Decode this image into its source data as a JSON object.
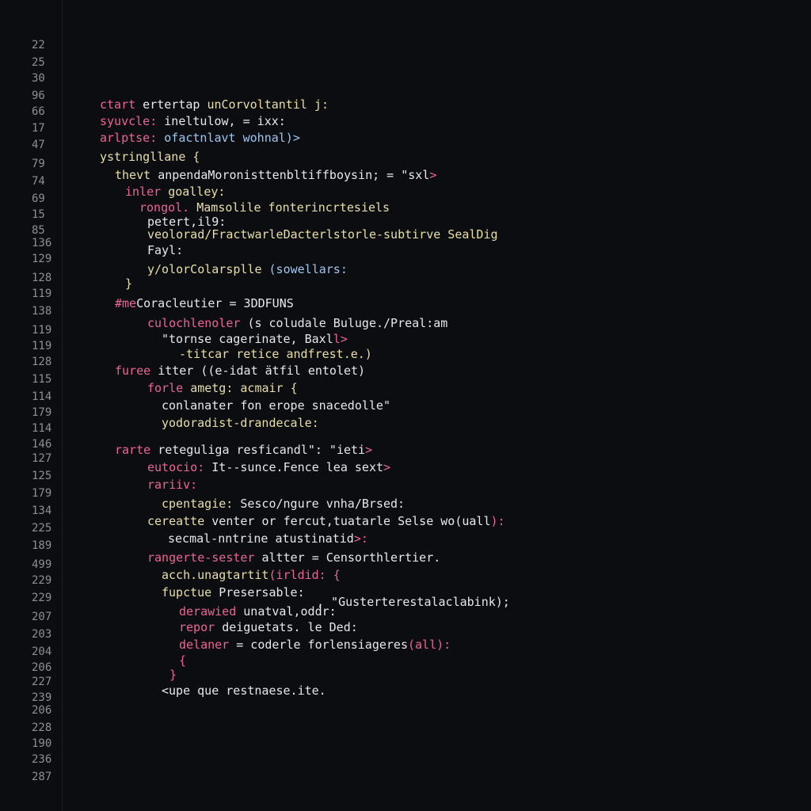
{
  "editor": {
    "theme": {
      "background": "#0b0d11",
      "keyword": "#ec6592",
      "function": "#e9dfa6",
      "text": "#e6e8ee",
      "accent": "#9fc6ee",
      "line_number": "#8c9096"
    },
    "line_numbers": [
      "22",
      "25",
      "30",
      "96",
      "66",
      "17",
      "47",
      "79",
      "74",
      "69",
      "15",
      "85",
      "136",
      "129",
      "128",
      "119",
      "138",
      "119",
      "119",
      "128",
      "115",
      "114",
      "179",
      "114",
      "146",
      "127",
      "125",
      "179",
      "134",
      "225",
      "189",
      "499",
      "229",
      "229",
      "207",
      "203",
      "204",
      "206",
      "227",
      "239",
      "206",
      "228",
      "190",
      "236",
      "287"
    ],
    "code_lines": [
      {
        "segments": [
          {
            "t": "ctart",
            "c": "k"
          },
          {
            "t": " ertertap ",
            "c": "w"
          },
          {
            "t": "unCorvoltantil j:",
            "c": "f"
          }
        ]
      },
      {
        "segments": [
          {
            "t": "syuvcle:",
            "c": "k"
          },
          {
            "t": " ineltulow, = ixx:",
            "c": "w"
          }
        ]
      },
      {
        "segments": [
          {
            "t": "arlptse:",
            "c": "k"
          },
          {
            "t": " ofactnlavt wohnal)>",
            "c": "b"
          }
        ]
      },
      {
        "segments": [
          {
            "t": "ystringllane {",
            "c": "f"
          }
        ]
      },
      {
        "segments": [
          {
            "t": "thevt ",
            "c": "f"
          },
          {
            "t": "anpendaMoronisttenbltiffboysin; = \"sxl",
            "c": "w"
          },
          {
            "t": ">",
            "c": "k"
          }
        ]
      },
      {
        "segments": [
          {
            "t": "inler ",
            "c": "k"
          },
          {
            "t": "goalley:",
            "c": "f"
          }
        ]
      },
      {
        "segments": [
          {
            "t": "rongol.",
            "c": "k"
          },
          {
            "t": " Mamsolile fonterincrtesiels",
            "c": "f"
          }
        ]
      },
      {
        "segments": [
          {
            "t": "petert,il9:",
            "c": "w"
          }
        ]
      },
      {
        "segments": [
          {
            "t": "veolorad/FractwarleDacterlstorle-subtirve SealDig",
            "c": "f"
          }
        ]
      },
      {
        "segments": [
          {
            "t": "Fayl:",
            "c": "w"
          }
        ]
      },
      {
        "segments": [
          {
            "t": "y/olorColarsplle ",
            "c": "f"
          },
          {
            "t": "(sowellars:",
            "c": "b"
          }
        ]
      },
      {
        "segments": [
          {
            "t": "}",
            "c": "f"
          }
        ]
      },
      {
        "segments": [
          {
            "t": "#me",
            "c": "k"
          },
          {
            "t": "Coracleutier = 3DDFUNS",
            "c": "w"
          }
        ]
      },
      {
        "segments": [
          {
            "t": "culochlenoler ",
            "c": "k"
          },
          {
            "t": "(s coludale Buluge./Preal:am",
            "c": "w"
          }
        ]
      },
      {
        "segments": [
          {
            "t": "\"tornse cagerinate, Baxl",
            "c": "w"
          },
          {
            "t": "l>",
            "c": "k"
          }
        ]
      },
      {
        "segments": [
          {
            "t": "-titcar retice andfrest.e.)",
            "c": "f"
          }
        ]
      },
      {
        "segments": [
          {
            "t": "furee ",
            "c": "k"
          },
          {
            "t": "itter ((e-idat ätfil entolet)",
            "c": "w"
          }
        ]
      },
      {
        "segments": [
          {
            "t": "forle ",
            "c": "k"
          },
          {
            "t": "ametg: acmair {",
            "c": "f"
          }
        ]
      },
      {
        "segments": [
          {
            "t": "conlanater fon erope snacedolle\"",
            "c": "w"
          }
        ]
      },
      {
        "segments": [
          {
            "t": "yodoradist-drandecale:",
            "c": "f"
          }
        ]
      },
      {
        "segments": [
          {
            "t": "rarte ",
            "c": "k"
          },
          {
            "t": "reteguliga resficandl\": \"ieti",
            "c": "w"
          },
          {
            "t": ">",
            "c": "k"
          }
        ]
      },
      {
        "segments": [
          {
            "t": "eutocio:",
            "c": "k"
          },
          {
            "t": " It--sunce.Fence lea sext",
            "c": "w"
          },
          {
            "t": ">",
            "c": "k"
          }
        ]
      },
      {
        "segments": [
          {
            "t": "rariiv:",
            "c": "k"
          }
        ]
      },
      {
        "segments": [
          {
            "t": "cpentagie:",
            "c": "f"
          },
          {
            "t": " Sesco/ngure vnha/Brsed:",
            "c": "w"
          }
        ]
      },
      {
        "segments": [
          {
            "t": "cereatte ",
            "c": "f"
          },
          {
            "t": "venter or fercut,tuatarle Selse wo(uall",
            "c": "w"
          },
          {
            "t": "):",
            "c": "k"
          }
        ]
      },
      {
        "segments": [
          {
            "t": "secmal-nntrine atustinatid",
            "c": "w"
          },
          {
            "t": ">:",
            "c": "k"
          }
        ]
      },
      {
        "segments": [
          {
            "t": "rangerte-sester ",
            "c": "k"
          },
          {
            "t": "altter = Censorthlertier.",
            "c": "w"
          }
        ]
      },
      {
        "segments": [
          {
            "t": "acch.unagtartit",
            "c": "f"
          },
          {
            "t": "(irldid: {",
            "c": "k"
          }
        ]
      },
      {
        "segments": [
          {
            "t": "fupctue ",
            "c": "f"
          },
          {
            "t": "Presersable:",
            "c": "w"
          }
        ]
      },
      {
        "segments": [
          {
            "t": ", \"Gusterterestalaclabink);",
            "c": "w"
          }
        ]
      },
      {
        "segments": [
          {
            "t": "derawied ",
            "c": "k"
          },
          {
            "t": "unatval,oddr:",
            "c": "w"
          }
        ]
      },
      {
        "segments": [
          {
            "t": "repor ",
            "c": "k"
          },
          {
            "t": "deiguetats. le Ded:",
            "c": "w"
          }
        ]
      },
      {
        "segments": [
          {
            "t": "delaner ",
            "c": "k"
          },
          {
            "t": "= coderle forlensiageres",
            "c": "w"
          },
          {
            "t": "(all):",
            "c": "k"
          }
        ]
      },
      {
        "segments": [
          {
            "t": "{",
            "c": "k"
          }
        ]
      },
      {
        "segments": [
          {
            "t": "}",
            "c": "k"
          }
        ]
      },
      {
        "segments": [
          {
            "t": "<upe que restnaese.ite.",
            "c": "w"
          }
        ]
      }
    ]
  }
}
